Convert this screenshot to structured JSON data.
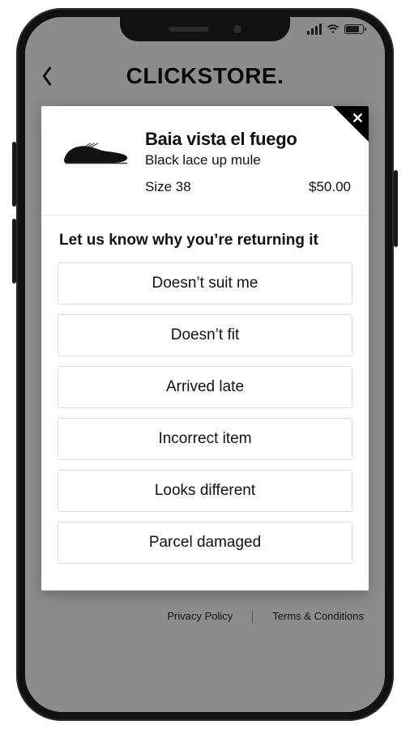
{
  "statusbar": {
    "signal_bars": 4,
    "wifi": true,
    "battery_pct": 80
  },
  "page": {
    "brand": "CLICKSTORE.",
    "footer": {
      "privacy": "Privacy Policy",
      "terms": "Terms & Conditions"
    }
  },
  "modal": {
    "product": {
      "name": "Baia vista el fuego",
      "description": "Black lace up mule",
      "size_label": "Size 38",
      "price": "$50.00"
    },
    "prompt": "Let us know why you’re returning it",
    "reasons": [
      "Doesn’t suit me",
      "Doesn’t fit",
      "Arrived late",
      "Incorrect item",
      "Looks different",
      "Parcel damaged"
    ]
  }
}
